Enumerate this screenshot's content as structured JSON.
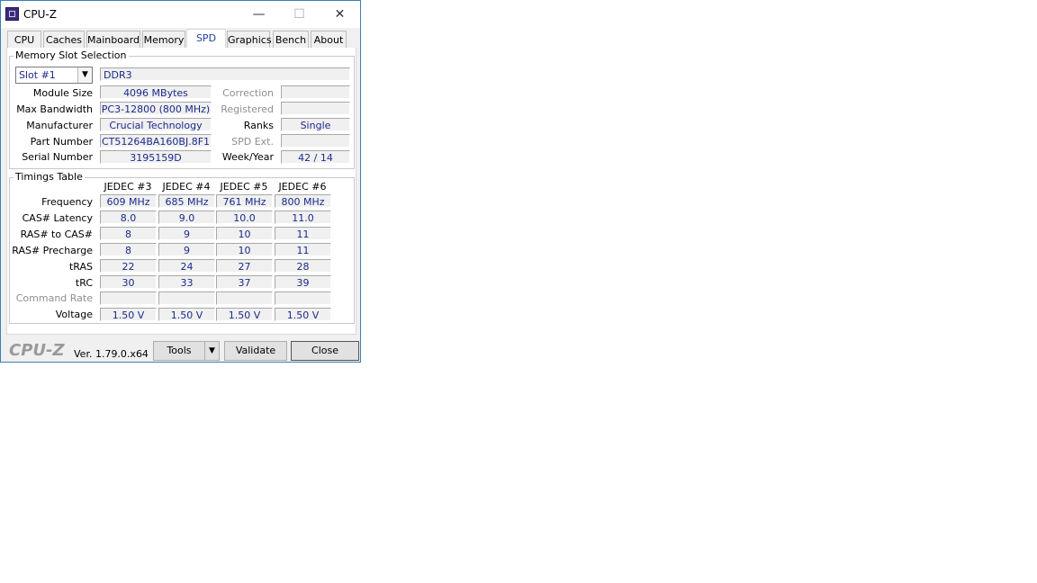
{
  "window": {
    "title": "CPU-Z",
    "minimize_glyph": "—",
    "maximize_glyph": "☐",
    "close_glyph": "✕"
  },
  "tabs": [
    {
      "label": "CPU"
    },
    {
      "label": "Caches"
    },
    {
      "label": "Mainboard"
    },
    {
      "label": "Memory"
    },
    {
      "label": "SPD",
      "active": true
    },
    {
      "label": "Graphics"
    },
    {
      "label": "Bench"
    },
    {
      "label": "About"
    }
  ],
  "slot": {
    "legend": "Memory Slot Selection",
    "selected": "Slot #1",
    "memory_type": "DDR3",
    "left_fields": [
      {
        "label": "Module Size",
        "value": "4096 MBytes"
      },
      {
        "label": "Max Bandwidth",
        "value": "PC3-12800 (800 MHz)"
      },
      {
        "label": "Manufacturer",
        "value": "Crucial Technology"
      },
      {
        "label": "Part Number",
        "value": "CT51264BA160BJ.8F1"
      },
      {
        "label": "Serial Number",
        "value": "3195159D"
      }
    ],
    "right_fields": [
      {
        "label": "Correction",
        "value": "",
        "disabled": true
      },
      {
        "label": "Registered",
        "value": "",
        "disabled": true
      },
      {
        "label": "Ranks",
        "value": "Single",
        "disabled": false
      },
      {
        "label": "SPD Ext.",
        "value": "",
        "disabled": true
      },
      {
        "label": "Week/Year",
        "value": "42 / 14",
        "disabled": false
      }
    ]
  },
  "timings": {
    "legend": "Timings Table",
    "columns": [
      "JEDEC #3",
      "JEDEC #4",
      "JEDEC #5",
      "JEDEC #6"
    ],
    "rows": [
      {
        "label": "Frequency",
        "values": [
          "609 MHz",
          "685 MHz",
          "761 MHz",
          "800 MHz"
        ]
      },
      {
        "label": "CAS# Latency",
        "values": [
          "8.0",
          "9.0",
          "10.0",
          "11.0"
        ]
      },
      {
        "label": "RAS# to CAS#",
        "values": [
          "8",
          "9",
          "10",
          "11"
        ]
      },
      {
        "label": "RAS# Precharge",
        "values": [
          "8",
          "9",
          "10",
          "11"
        ]
      },
      {
        "label": "tRAS",
        "values": [
          "22",
          "24",
          "27",
          "28"
        ]
      },
      {
        "label": "tRC",
        "values": [
          "30",
          "33",
          "37",
          "39"
        ]
      },
      {
        "label": "Command Rate",
        "values": [
          "",
          "",
          "",
          ""
        ],
        "disabled": true
      },
      {
        "label": "Voltage",
        "values": [
          "1.50 V",
          "1.50 V",
          "1.50 V",
          "1.50 V"
        ]
      }
    ]
  },
  "footer": {
    "logo": "CPU-Z",
    "version": "Ver. 1.79.0.x64",
    "tools_label": "Tools",
    "validate_label": "Validate",
    "close_label": "Close"
  }
}
